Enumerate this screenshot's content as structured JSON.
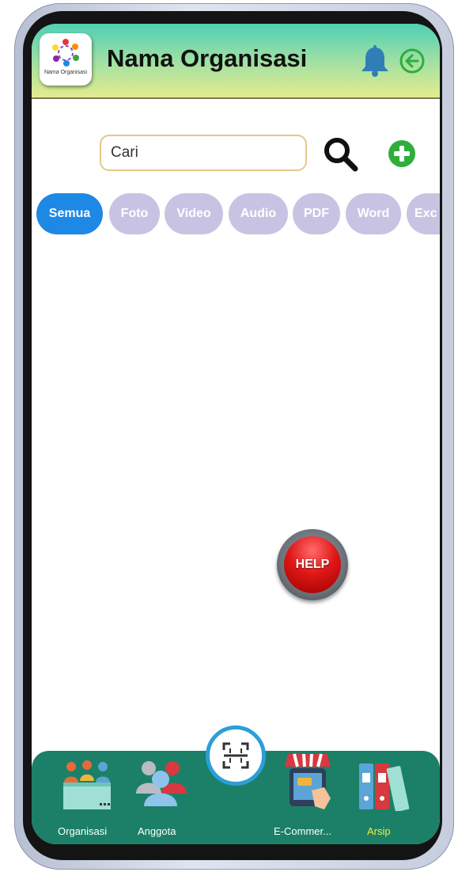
{
  "app": {
    "logo_text": "Nama Organisasi",
    "title": "Nama Organisasi"
  },
  "icons": {
    "bell": "bell-icon",
    "back": "arrow-left-circle-icon",
    "search": "search-icon",
    "add": "plus-circle-icon",
    "scan": "scan-icon"
  },
  "search": {
    "placeholder": "Cari"
  },
  "filters": [
    {
      "label": "Semua",
      "active": true
    },
    {
      "label": "Foto",
      "active": false
    },
    {
      "label": "Video",
      "active": false
    },
    {
      "label": "Audio",
      "active": false
    },
    {
      "label": "PDF",
      "active": false
    },
    {
      "label": "Word",
      "active": false
    },
    {
      "label": "Exc",
      "active": false
    }
  ],
  "help": {
    "label": "HELP"
  },
  "nav": {
    "items": [
      {
        "label": "Organisasi",
        "icon": "organization-icon",
        "active": false
      },
      {
        "label": "Anggota",
        "icon": "members-icon",
        "active": false
      },
      {
        "label": "E-Commer...",
        "icon": "ecommerce-icon",
        "active": false
      },
      {
        "label": "Arsip",
        "icon": "archive-icon",
        "active": true
      }
    ]
  },
  "colors": {
    "active_chip": "#1e88e5",
    "inactive_chip": "#c9c3e3",
    "nav_bg": "#1b8067",
    "active_nav_label": "#f3ef3a",
    "add_button": "#2fae3c"
  }
}
